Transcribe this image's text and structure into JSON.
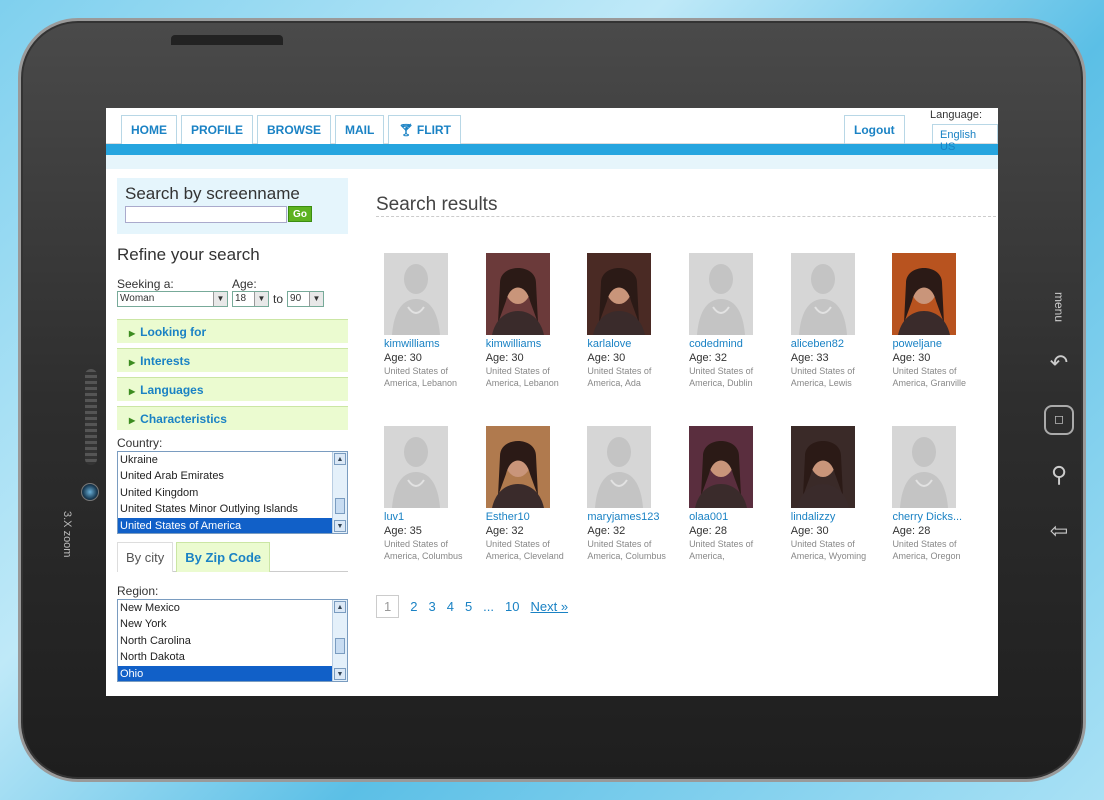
{
  "device": {
    "brand": "3.X zoom",
    "side_buttons": [
      {
        "name": "menu-icon",
        "label": "menu"
      },
      {
        "name": "back-icon",
        "glyph": "↶"
      },
      {
        "name": "home-icon",
        "glyph": "◻"
      },
      {
        "name": "search-icon",
        "glyph": "⚲"
      },
      {
        "name": "return-icon",
        "glyph": "⇦"
      }
    ]
  },
  "nav": {
    "tabs": [
      {
        "label": "HOME"
      },
      {
        "label": "PROFILE"
      },
      {
        "label": "BROWSE"
      },
      {
        "label": "MAIL"
      },
      {
        "label": "FLIRT",
        "icon": "cocktail-icon"
      }
    ],
    "logout": "Logout",
    "language_label": "Language:",
    "language_value": "English US"
  },
  "sidebar": {
    "search_title": "Search by screenname",
    "search_value": "",
    "go_label": "Go",
    "refine_title": "Refine your search",
    "seeking_label": "Seeking a:",
    "seeking_value": "Woman",
    "age_label": "Age:",
    "age_from": "18",
    "age_to_label": "to",
    "age_to": "90",
    "sections": [
      "Looking for",
      "Interests",
      "Languages",
      "Characteristics"
    ],
    "country_label": "Country:",
    "countries": [
      "Ukraine",
      "United Arab Emirates",
      "United Kingdom",
      "United States Minor Outlying Islands",
      "United States of America"
    ],
    "country_selected": "United States of America",
    "city_tabs": [
      "By city",
      "By Zip Code"
    ],
    "region_label": "Region:",
    "regions": [
      "New Mexico",
      "New York",
      "North Carolina",
      "North Dakota",
      "Ohio"
    ],
    "region_selected": "Ohio"
  },
  "results": {
    "title": "Search results",
    "profiles": [
      {
        "name": "kimwilliams",
        "age": "Age: 30",
        "loc": "United States of America, Lebanon",
        "photo": "placeholder"
      },
      {
        "name": "kimwilliams",
        "age": "Age: 30",
        "loc": "United States of America, Lebanon",
        "photo": "photo",
        "color": "#6b3a3a"
      },
      {
        "name": "karlalove",
        "age": "Age: 30",
        "loc": "United States of America, Ada",
        "photo": "photo",
        "color": "#4a2a24"
      },
      {
        "name": "codedmind",
        "age": "Age: 32",
        "loc": "United States of America, Dublin",
        "photo": "placeholder"
      },
      {
        "name": "aliceben82",
        "age": "Age: 33",
        "loc": "United States of America, Lewis Center",
        "photo": "placeholder"
      },
      {
        "name": "poweljane",
        "age": "Age: 30",
        "loc": "United States of America, Granville",
        "photo": "photo",
        "color": "#b8531f"
      },
      {
        "name": "luv1",
        "age": "Age: 35",
        "loc": "United States of America, Columbus",
        "photo": "placeholder"
      },
      {
        "name": "Esther10",
        "age": "Age: 32",
        "loc": "United States of America, Cleveland",
        "photo": "photo",
        "color": "#b07a4e"
      },
      {
        "name": "maryjames123",
        "age": "Age: 32",
        "loc": "United States of America, Columbus",
        "photo": "placeholder"
      },
      {
        "name": "olaa001",
        "age": "Age: 28",
        "loc": "United States of America, Westerville",
        "photo": "photo",
        "color": "#5a2e3e"
      },
      {
        "name": "lindalizzy",
        "age": "Age: 30",
        "loc": "United States of America, Wyoming",
        "photo": "photo",
        "color": "#3a2a28"
      },
      {
        "name": "cherry Dicks...",
        "age": "Age: 28",
        "loc": "United States of America, Oregon",
        "photo": "placeholder"
      }
    ],
    "pages": [
      "1",
      "2",
      "3",
      "4",
      "5",
      "...",
      "10"
    ],
    "current_page": "1",
    "next_label": "Next »"
  },
  "colors": {
    "accent": "#1a82c4",
    "band": "#26a5df",
    "go": "#5db21f",
    "selected": "#1160c8"
  }
}
